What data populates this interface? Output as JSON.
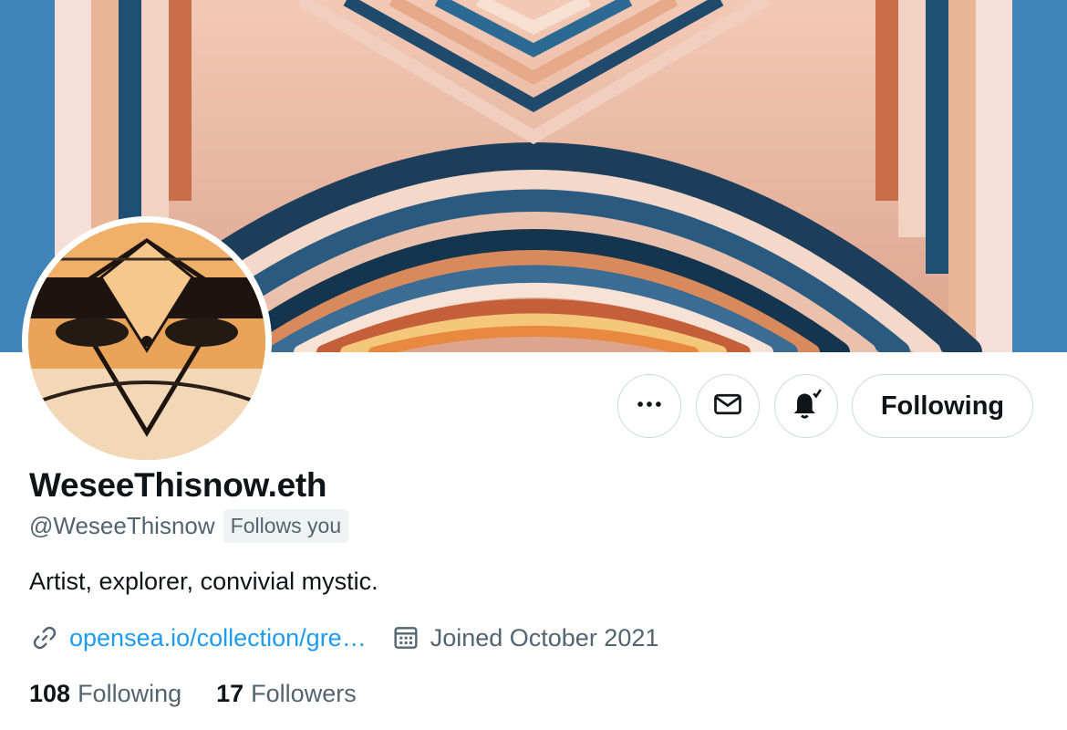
{
  "profile": {
    "display_name": "WeseeThisnow.eth",
    "handle": "@WeseeThisnow",
    "follows_you_badge": "Follows you",
    "bio": "Artist, explorer, convivial mystic.",
    "website": "opensea.io/collection/gre…",
    "joined": "Joined October 2021"
  },
  "stats": {
    "following_count": "108",
    "following_label": "Following",
    "followers_count": "17",
    "followers_label": "Followers"
  },
  "actions": {
    "more_icon": "more-horizontal-icon",
    "message_icon": "envelope-icon",
    "notify_icon": "bell-subscribed-icon",
    "follow_label": "Following"
  },
  "icons": {
    "link": "link-icon",
    "calendar": "calendar-icon"
  },
  "colors": {
    "accent": "#1d9bf0",
    "text_primary": "#0f1419",
    "text_secondary": "#536471",
    "border": "#cfd9de"
  }
}
